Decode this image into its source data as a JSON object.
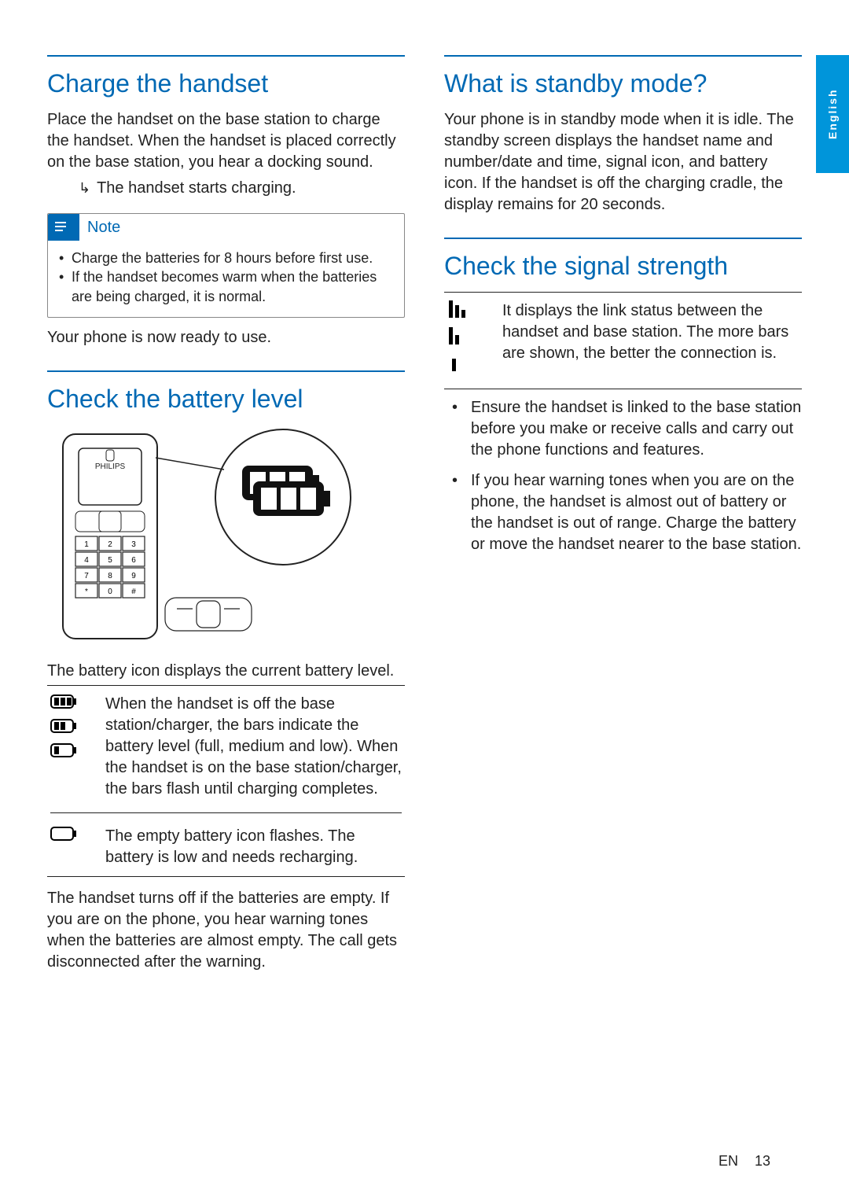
{
  "langTab": "English",
  "footer": {
    "lang": "EN",
    "page": "13"
  },
  "left": {
    "s1": {
      "heading": "Charge the handset",
      "p1": "Place the handset on the base station to charge the handset. When the handset is placed correctly on the base station, you hear a docking sound.",
      "result": "The handset starts charging.",
      "noteLabel": "Note",
      "noteItems": [
        "Charge the batteries for 8 hours before first use.",
        "If the handset becomes warm when the batteries are being charged, it is normal."
      ],
      "p2": "Your phone is now ready to use."
    },
    "s2": {
      "heading": "Check the battery level",
      "p1": "The battery icon displays the current battery level.",
      "row1": "When the handset is off the base station/charger, the bars indicate the battery level (full, medium and low). When the handset is on the base station/charger, the bars flash until charging completes.",
      "row2": "The empty battery icon flashes. The battery is low and needs recharging.",
      "p2": "The handset turns off if the batteries are empty. If you are on the phone, you hear warning tones when the batteries are almost empty. The call gets disconnected after the warning."
    }
  },
  "right": {
    "s1": {
      "heading": "What is standby mode?",
      "p1": "Your phone is in standby mode when it is idle. The standby screen displays the handset name and number/date and time, signal icon, and battery icon. If the handset is off the charging cradle, the display remains for 20 seconds."
    },
    "s2": {
      "heading": "Check the signal strength",
      "row1": "It displays the link status between the handset and base station. The more bars are shown, the better the connection is.",
      "bullets": [
        "Ensure the handset is linked to the base station before you make or receive calls and carry out the phone functions and features.",
        "If you hear warning tones when you are on the phone, the handset is almost out of battery or the handset is out of range. Charge the battery or move the handset nearer to the base station."
      ]
    }
  }
}
